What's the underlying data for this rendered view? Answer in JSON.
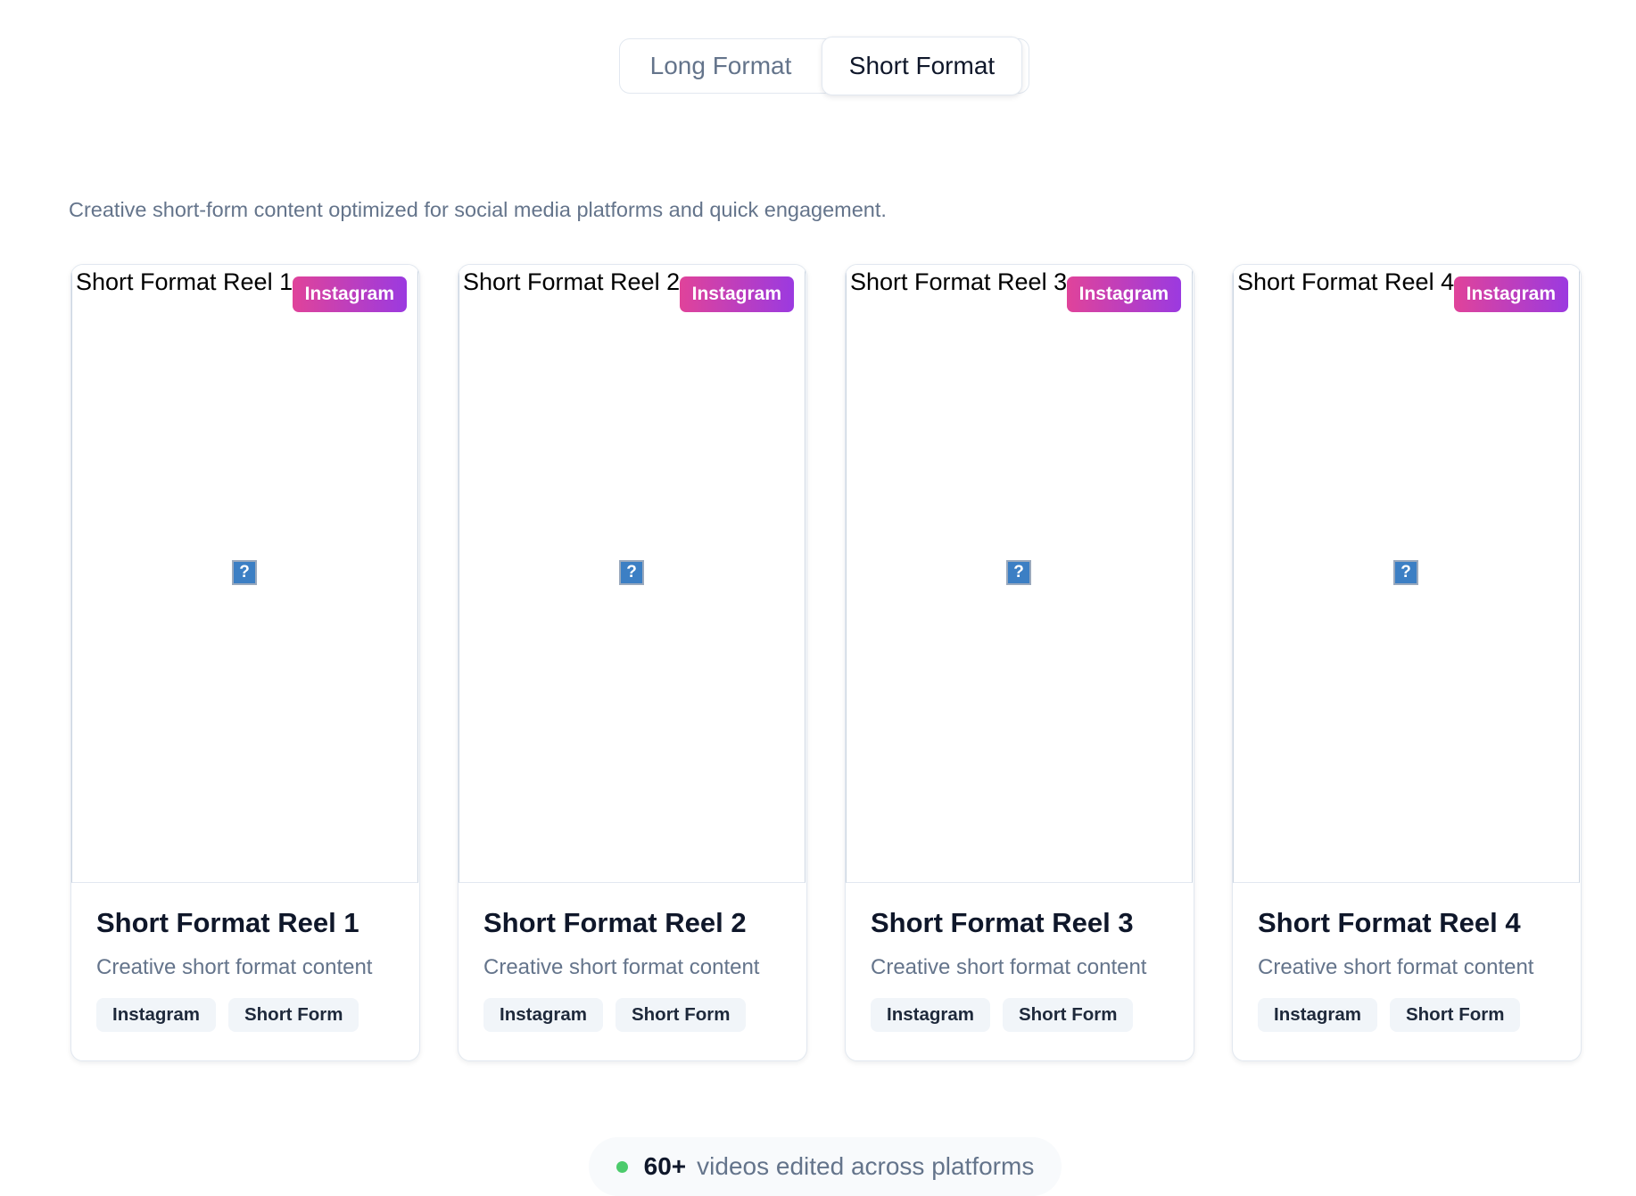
{
  "toggle": {
    "long_label": "Long Format",
    "short_label": "Short Format",
    "active": "Short Format"
  },
  "description": "Creative short-form content optimized for social media platforms and quick engagement.",
  "cards": [
    {
      "alt": "Short Format Reel 1",
      "badge": "Instagram",
      "title": "Short Format Reel 1",
      "subtitle": "Creative short format content",
      "tags": [
        "Instagram",
        "Short Form"
      ]
    },
    {
      "alt": "Short Format Reel 2",
      "badge": "Instagram",
      "title": "Short Format Reel 2",
      "subtitle": "Creative short format content",
      "tags": [
        "Instagram",
        "Short Form"
      ]
    },
    {
      "alt": "Short Format Reel 3",
      "badge": "Instagram",
      "title": "Short Format Reel 3",
      "subtitle": "Creative short format content",
      "tags": [
        "Instagram",
        "Short Form"
      ]
    },
    {
      "alt": "Short Format Reel 4",
      "badge": "Instagram",
      "title": "Short Format Reel 4",
      "subtitle": "Creative short format content",
      "tags": [
        "Instagram",
        "Short Form"
      ]
    }
  ],
  "stats": {
    "count": "60+",
    "text": "videos edited across platforms"
  },
  "icons": {
    "broken_image": "broken-image-icon",
    "status_dot": "status-dot-icon"
  },
  "colors": {
    "badge_gradient_start": "#e0439a",
    "badge_gradient_end": "#9b3ae0",
    "status_dot": "#4ccb6c",
    "muted_text": "#64748b"
  }
}
